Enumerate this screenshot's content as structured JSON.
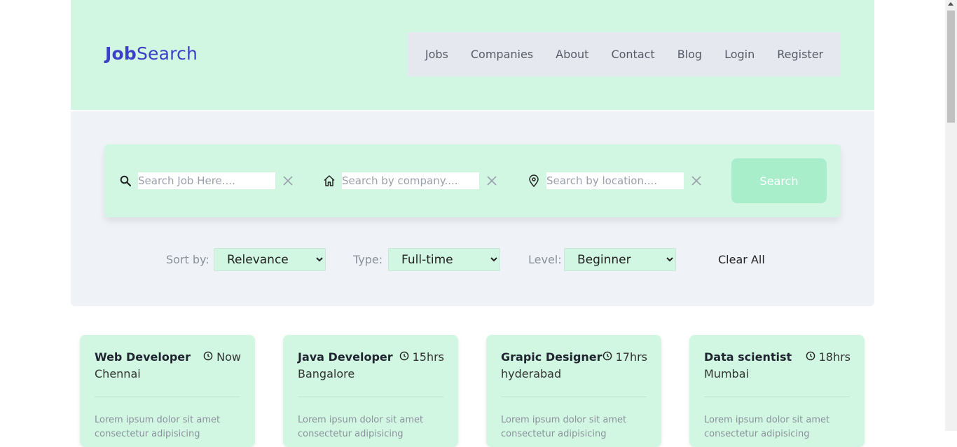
{
  "logo": {
    "bold": "Job",
    "regular": "Search"
  },
  "nav": [
    "Jobs",
    "Companies",
    "About",
    "Contact",
    "Blog",
    "Login",
    "Register"
  ],
  "search": {
    "job_placeholder": "Search Job Here....",
    "company_placeholder": "Search by company....",
    "location_placeholder": "Search by location....",
    "button_label": "Search"
  },
  "filters": {
    "sort_label": "Sort by:",
    "sort_value": "Relevance",
    "type_label": "Type:",
    "type_value": "Full-time",
    "level_label": "Level:",
    "level_value": "Beginner",
    "clear_all": "Clear All"
  },
  "jobs": [
    {
      "title": "Web Developer",
      "city": "Chennai",
      "time": "Now",
      "desc": "Lorem ipsum dolor sit amet consectetur adipisicing"
    },
    {
      "title": "Java Developer",
      "city": "Bangalore",
      "time": "15hrs",
      "desc": "Lorem ipsum dolor sit amet consectetur adipisicing"
    },
    {
      "title": "Grapic Designer",
      "city": "hyderabad",
      "time": "17hrs",
      "desc": "Lorem ipsum dolor sit amet consectetur adipisicing"
    },
    {
      "title": "Data scientist",
      "city": "Mumbai",
      "time": "18hrs",
      "desc": "Lorem ipsum dolor sit amet consectetur adipisicing"
    }
  ],
  "colors": {
    "mint": "#d1f7e2",
    "panel": "#eff2f7",
    "nav_bg": "#e5e8ef",
    "brand": "#3c3fc7",
    "button": "#a9eecb"
  },
  "icons": {
    "job_field": "search-icon",
    "company_field": "home-icon",
    "location_field": "location-pin-icon",
    "clear": "close-icon",
    "time": "clock-icon"
  }
}
